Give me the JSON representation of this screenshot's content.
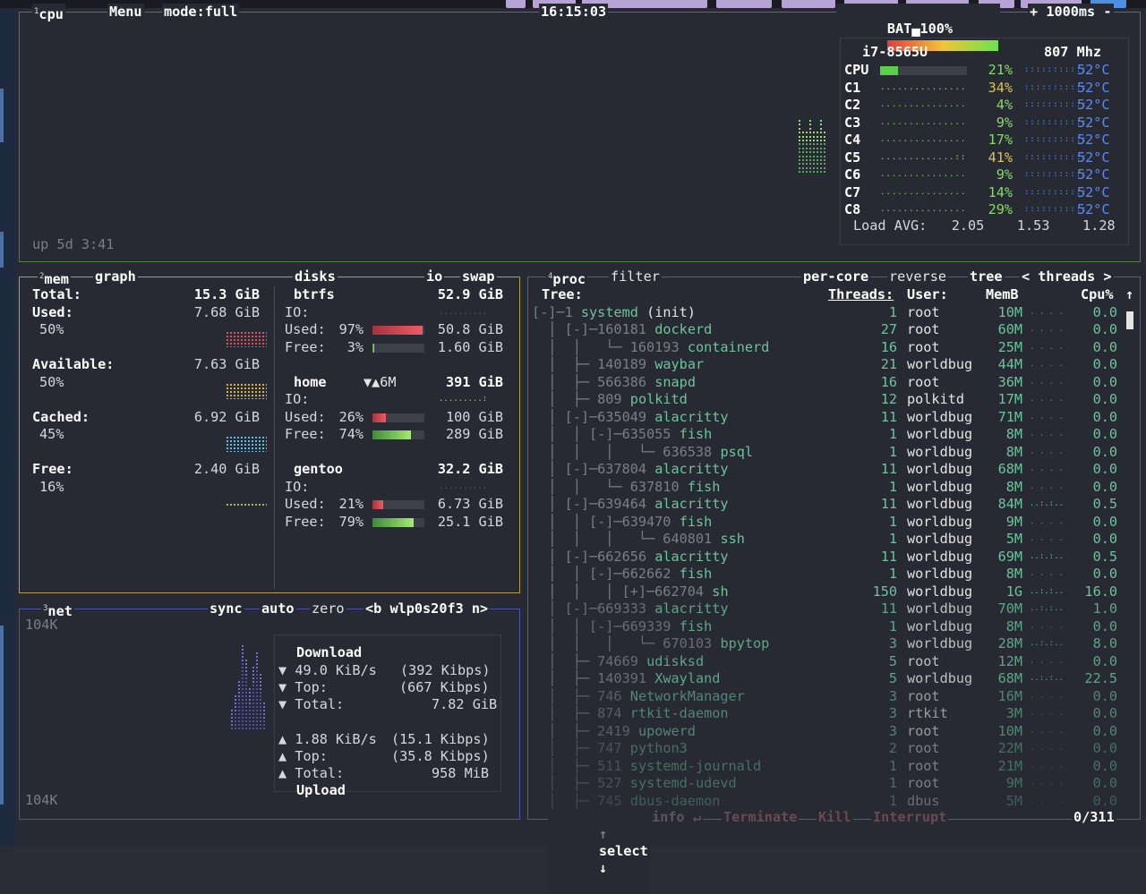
{
  "cpu": {
    "index": "1",
    "title": "cpu",
    "menu": "Menu",
    "mode": "mode:full",
    "clock": "16:15:03",
    "battery_label": "BAT",
    "battery_percent": "100%",
    "interval_plus": "+",
    "interval": "1000ms",
    "interval_minus": "-",
    "model": "i7-8565U",
    "freq": "807 Mhz",
    "uptime": "up 5d 3:41",
    "load_label": "Load AVG:",
    "load": [
      "2.05",
      "1.53",
      "1.28"
    ],
    "cores": [
      {
        "name": "CPU",
        "pct": "21%",
        "temp": "52°C",
        "level": 0.21
      },
      {
        "name": "C1",
        "pct": "34%",
        "temp": "52°C",
        "level": 0.34
      },
      {
        "name": "C2",
        "pct": "4%",
        "temp": "52°C",
        "level": 0.04
      },
      {
        "name": "C3",
        "pct": "9%",
        "temp": "52°C",
        "level": 0.09
      },
      {
        "name": "C4",
        "pct": "17%",
        "temp": "52°C",
        "level": 0.17
      },
      {
        "name": "C5",
        "pct": "41%",
        "temp": "52°C",
        "level": 0.41
      },
      {
        "name": "C6",
        "pct": "9%",
        "temp": "52°C",
        "level": 0.09
      },
      {
        "name": "C7",
        "pct": "14%",
        "temp": "52°C",
        "level": 0.14
      },
      {
        "name": "C8",
        "pct": "29%",
        "temp": "52°C",
        "level": 0.29
      }
    ]
  },
  "mem": {
    "index": "2",
    "title": "mem",
    "graph": "graph",
    "rows": [
      {
        "label": "Total:",
        "value": "15.3 GiB",
        "pct": ""
      },
      {
        "label": "Used:",
        "value": "7.68 GiB",
        "pct": "50%"
      },
      {
        "label": "Available:",
        "value": "7.63 GiB",
        "pct": "50%"
      },
      {
        "label": "Cached:",
        "value": "6.92 GiB",
        "pct": "45%"
      },
      {
        "label": "Free:",
        "value": "2.40 GiB",
        "pct": "16%"
      }
    ]
  },
  "disks": {
    "title": "disks",
    "io": "io",
    "swap": "swap",
    "io_label": "IO:",
    "used_label": "Used:",
    "free_label": "Free:",
    "list": [
      {
        "name": "btrfs",
        "total": "52.9 GiB",
        "io": "",
        "used_pct": "97%",
        "used": "50.8 GiB",
        "free_pct": "3%",
        "free": "1.60 GiB",
        "used_level": 0.97,
        "free_level": 0.03
      },
      {
        "name": "home",
        "total": "391 GiB",
        "io": "▼▲6M",
        "used_pct": "26%",
        "used": "100 GiB",
        "free_pct": "74%",
        "free": "289 GiB",
        "used_level": 0.26,
        "free_level": 0.74
      },
      {
        "name": "gentoo",
        "total": "32.2 GiB",
        "io": "",
        "used_pct": "21%",
        "used": "6.73 GiB",
        "free_pct": "79%",
        "free": "25.1 GiB",
        "used_level": 0.21,
        "free_level": 0.79
      }
    ]
  },
  "net": {
    "index": "3",
    "title": "net",
    "sync": "sync",
    "auto": "auto",
    "zero": "zero",
    "prev": "<b",
    "iface": "wlp0s20f3",
    "next": "n>",
    "scale_top": "104K",
    "scale_bottom": "104K",
    "download": "Download",
    "upload": "Upload",
    "down_arrow": "▼",
    "up_arrow": "▲",
    "down_rate": "49.0 KiB/s",
    "down_rate_bits": "(392 Kibps)",
    "down_top_label": "Top:",
    "down_top": "(667 Kibps)",
    "down_total_label": "Total:",
    "down_total": "7.82 GiB",
    "up_rate": "1.88 KiB/s",
    "up_rate_bits": "(15.1 Kibps)",
    "up_top_label": "Top:",
    "up_top": "(35.8 Kibps)",
    "up_total_label": "Total:",
    "up_total": "958 MiB"
  },
  "proc": {
    "index": "4",
    "title": "proc",
    "filter": "filter",
    "per_core": "per-core",
    "reverse": "reverse",
    "tree": "tree",
    "threads_sel": "< threads >",
    "headers": {
      "tree": "Tree:",
      "threads": "Threads:",
      "user": "User:",
      "mem": "MemB",
      "cpu": "Cpu%",
      "arrow": "↑"
    },
    "footer": {
      "select": "select",
      "up_arrow": "↑",
      "down_arrow": "↓",
      "info": "info",
      "enter": "↵",
      "terminate": "Terminate",
      "kill": "Kill",
      "interrupt": "Interrupt",
      "count": "0/311"
    },
    "rows": [
      {
        "prefix": "[-]─1 ",
        "name": "systemd",
        "suffix": " (init)",
        "threads": "1",
        "user": "root",
        "mem": "10M",
        "cpu": "0.0",
        "fade": 0
      },
      {
        "prefix": "  │ [-]─160181 ",
        "name": "dockerd",
        "suffix": "",
        "threads": "27",
        "user": "root",
        "mem": "60M",
        "cpu": "0.0",
        "fade": 0
      },
      {
        "prefix": "  │  │   └─ 160193 ",
        "name": "containerd",
        "suffix": "",
        "threads": "16",
        "user": "root",
        "mem": "25M",
        "cpu": "0.0",
        "fade": 0
      },
      {
        "prefix": "  │  ├─ 140189 ",
        "name": "waybar",
        "suffix": "",
        "threads": "21",
        "user": "worldbug",
        "mem": "44M",
        "cpu": "0.0",
        "fade": 0
      },
      {
        "prefix": "  │  ├─ 566386 ",
        "name": "snapd",
        "suffix": "",
        "threads": "16",
        "user": "root",
        "mem": "36M",
        "cpu": "0.0",
        "fade": 0
      },
      {
        "prefix": "  │  ├─ 809 ",
        "name": "polkitd",
        "suffix": "",
        "threads": "12",
        "user": "polkitd",
        "mem": "17M",
        "cpu": "0.0",
        "fade": 0
      },
      {
        "prefix": "  │ [-]─635049 ",
        "name": "alacritty",
        "suffix": "",
        "threads": "11",
        "user": "worldbug",
        "mem": "71M",
        "cpu": "0.0",
        "fade": 0
      },
      {
        "prefix": "  │  │ [-]─635055 ",
        "name": "fish",
        "suffix": "",
        "threads": "1",
        "user": "worldbug",
        "mem": "8M",
        "cpu": "0.0",
        "fade": 0
      },
      {
        "prefix": "  │  │   │   └─ 636538 ",
        "name": "psql",
        "suffix": "",
        "threads": "1",
        "user": "worldbug",
        "mem": "8M",
        "cpu": "0.0",
        "fade": 0
      },
      {
        "prefix": "  │ [-]─637804 ",
        "name": "alacritty",
        "suffix": "",
        "threads": "11",
        "user": "worldbug",
        "mem": "68M",
        "cpu": "0.0",
        "fade": 0
      },
      {
        "prefix": "  │  │   └─ 637810 ",
        "name": "fish",
        "suffix": "",
        "threads": "1",
        "user": "worldbug",
        "mem": "8M",
        "cpu": "0.0",
        "fade": 0
      },
      {
        "prefix": "  │ [-]─639464 ",
        "name": "alacritty",
        "suffix": "",
        "threads": "11",
        "user": "worldbug",
        "mem": "84M",
        "cpu": "0.5",
        "fade": 0
      },
      {
        "prefix": "  │  │ [-]─639470 ",
        "name": "fish",
        "suffix": "",
        "threads": "1",
        "user": "worldbug",
        "mem": "9M",
        "cpu": "0.0",
        "fade": 0
      },
      {
        "prefix": "  │  │   │   └─ 640801 ",
        "name": "ssh",
        "suffix": "",
        "threads": "1",
        "user": "worldbug",
        "mem": "5M",
        "cpu": "0.0",
        "fade": 0
      },
      {
        "prefix": "  │ [-]─662656 ",
        "name": "alacritty",
        "suffix": "",
        "threads": "11",
        "user": "worldbug",
        "mem": "69M",
        "cpu": "0.5",
        "fade": 0
      },
      {
        "prefix": "  │  │ [-]─662662 ",
        "name": "fish",
        "suffix": "",
        "threads": "1",
        "user": "worldbug",
        "mem": "8M",
        "cpu": "0.0",
        "fade": 0
      },
      {
        "prefix": "  │  │   │ [+]─662704 ",
        "name": "sh",
        "suffix": "",
        "threads": "150",
        "user": "worldbug",
        "mem": "1G",
        "cpu": "16.0",
        "fade": 0
      },
      {
        "prefix": "  │ [-]─669333 ",
        "name": "alacritty",
        "suffix": "",
        "threads": "11",
        "user": "worldbug",
        "mem": "70M",
        "cpu": "1.0",
        "fade": 1
      },
      {
        "prefix": "  │  │ [-]─669339 ",
        "name": "fish",
        "suffix": "",
        "threads": "1",
        "user": "worldbug",
        "mem": "8M",
        "cpu": "0.0",
        "fade": 1
      },
      {
        "prefix": "  │  │   │   └─ 670103 ",
        "name": "bpytop",
        "suffix": "",
        "threads": "3",
        "user": "worldbug",
        "mem": "28M",
        "cpu": "8.0",
        "fade": 1
      },
      {
        "prefix": "  │  ├─ 74669 ",
        "name": "udisksd",
        "suffix": "",
        "threads": "5",
        "user": "root",
        "mem": "12M",
        "cpu": "0.0",
        "fade": 1
      },
      {
        "prefix": "  │  ├─ 140391 ",
        "name": "Xwayland",
        "suffix": "",
        "threads": "5",
        "user": "worldbug",
        "mem": "68M",
        "cpu": "22.5",
        "fade": 1
      },
      {
        "prefix": "  │  ├─ 746 ",
        "name": "NetworkManager",
        "suffix": "",
        "threads": "3",
        "user": "root",
        "mem": "16M",
        "cpu": "0.0",
        "fade": 2
      },
      {
        "prefix": "  │  ├─ 874 ",
        "name": "rtkit-daemon",
        "suffix": "",
        "threads": "3",
        "user": "rtkit",
        "mem": "3M",
        "cpu": "0.0",
        "fade": 2
      },
      {
        "prefix": "  │  ├─ 2419 ",
        "name": "upowerd",
        "suffix": "",
        "threads": "3",
        "user": "root",
        "mem": "10M",
        "cpu": "0.0",
        "fade": 2
      },
      {
        "prefix": "  │  ├─ 747 ",
        "name": "python3",
        "suffix": "",
        "threads": "2",
        "user": "root",
        "mem": "22M",
        "cpu": "0.0",
        "fade": 3
      },
      {
        "prefix": "  │  ├─ 511 ",
        "name": "systemd-journald",
        "suffix": "",
        "threads": "1",
        "user": "root",
        "mem": "21M",
        "cpu": "0.0",
        "fade": 3
      },
      {
        "prefix": "  │  ├─ 527 ",
        "name": "systemd-udevd",
        "suffix": "",
        "threads": "1",
        "user": "root",
        "mem": "9M",
        "cpu": "0.0",
        "fade": 3
      },
      {
        "prefix": "  │  ├─ 745 ",
        "name": "dbus-daemon",
        "suffix": "",
        "threads": "1",
        "user": "dbus",
        "mem": "5M",
        "cpu": "0.0",
        "fade": 4
      }
    ]
  },
  "colors": {
    "cpu_border": "#4e7d4a",
    "mem_border": "#b3a046",
    "net_border": "#4a4fb0",
    "proc_border": "#a1424d",
    "accent_green": "#87d968",
    "accent_blue": "#5b8cf2"
  }
}
